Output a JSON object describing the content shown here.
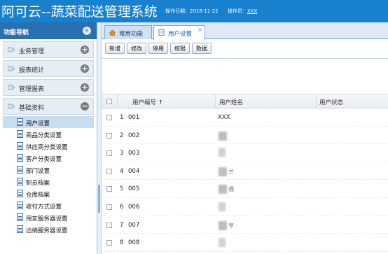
{
  "header": {
    "app_title": "阿可云--蔬菜配送管理系统",
    "date_label": "操作日期：",
    "date_value": "2016-11-22",
    "operator_label": "操作员：",
    "operator_value": "XXX"
  },
  "sidebar": {
    "title": "功能导航",
    "collapse_symbol": "«",
    "sections": [
      {
        "label": "业务管理",
        "toggle": "+"
      },
      {
        "label": "报表统计",
        "toggle": "+"
      },
      {
        "label": "管理报表",
        "toggle": "+"
      },
      {
        "label": "基础资料",
        "toggle": "−"
      }
    ],
    "items": [
      {
        "label": "用户设置"
      },
      {
        "label": "商品分类设置"
      },
      {
        "label": "供应商分类设置"
      },
      {
        "label": "客户分类设置"
      },
      {
        "label": "部门设置"
      },
      {
        "label": "职员档案"
      },
      {
        "label": "仓库档案"
      },
      {
        "label": "收付方式设置"
      },
      {
        "label": "用友服务器设置"
      },
      {
        "label": "出纳服务器设置"
      }
    ]
  },
  "tabs": {
    "home": "常用功能",
    "active": "用户设置",
    "close": "×"
  },
  "toolbar": {
    "add": "新增",
    "edit": "修改",
    "disable": "停用",
    "permission": "权限",
    "data": "数据"
  },
  "grid": {
    "columns": {
      "code": "用户编号 ↑",
      "name": "用户姓名",
      "status": "用户状态"
    },
    "rows": [
      {
        "num": "1",
        "code": "001",
        "name": "XXX",
        "tail": ""
      },
      {
        "num": "2",
        "code": "002",
        "name": "",
        "tail": ""
      },
      {
        "num": "3",
        "code": "003",
        "name": "",
        "tail": ""
      },
      {
        "num": "4",
        "code": "004",
        "name": "",
        "tail": "兰"
      },
      {
        "num": "5",
        "code": "005",
        "name": "",
        "tail": "通"
      },
      {
        "num": "6",
        "code": "006",
        "name": "",
        "tail": ""
      },
      {
        "num": "7",
        "code": "007",
        "name": "",
        "tail": "亨"
      },
      {
        "num": "8",
        "code": "008",
        "name": "",
        "tail": ""
      }
    ]
  },
  "colors": {
    "header_bg": "#1780cf",
    "sidebar_head_bg": "#2a6fb0",
    "selected_item_bg": "#c9ddf1"
  }
}
